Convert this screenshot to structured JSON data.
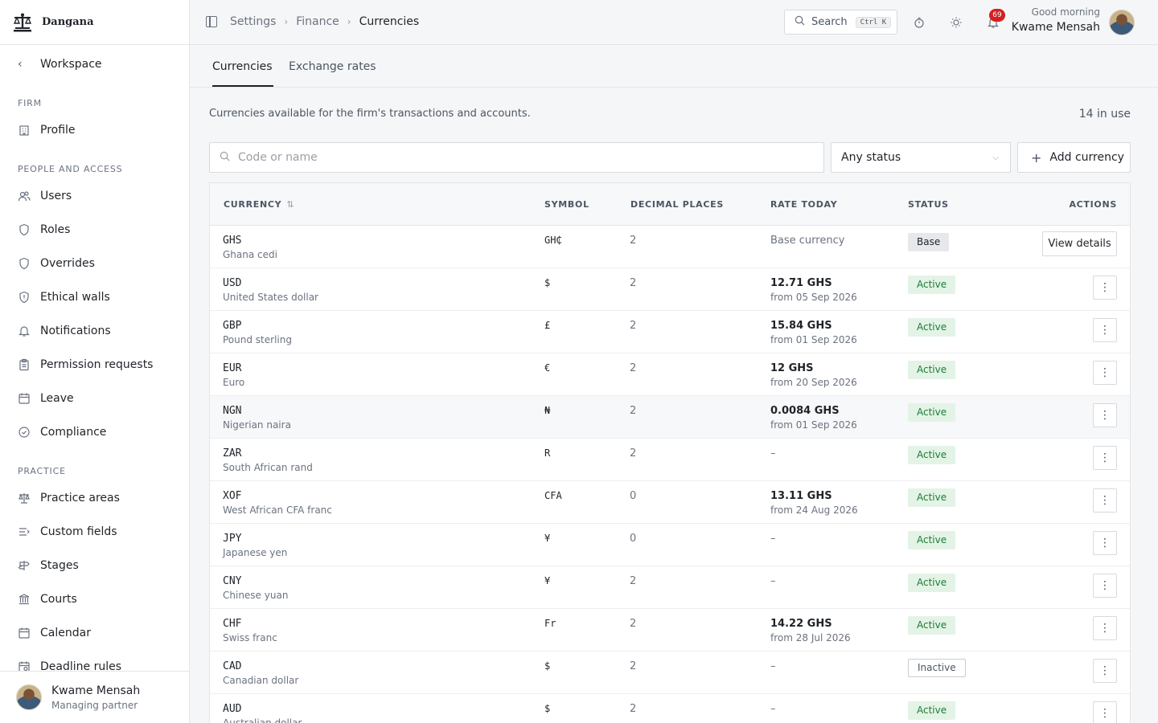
{
  "brand": {
    "name": "Dangana"
  },
  "sidebar": {
    "back_label": "Workspace",
    "sections": {
      "firm": "FIRM",
      "people": "PEOPLE AND ACCESS",
      "practice": "PRACTICE"
    },
    "items": [
      {
        "label": "Profile",
        "icon": "building-icon"
      },
      {
        "label": "Users",
        "icon": "users-icon"
      },
      {
        "label": "Roles",
        "icon": "shield-icon"
      },
      {
        "label": "Overrides",
        "icon": "shield-icon"
      },
      {
        "label": "Ethical walls",
        "icon": "shield-alert-icon"
      },
      {
        "label": "Notifications",
        "icon": "bell-icon"
      },
      {
        "label": "Permission requests",
        "icon": "clipboard-icon"
      },
      {
        "label": "Leave",
        "icon": "calendar-icon"
      },
      {
        "label": "Compliance",
        "icon": "check-circle-icon"
      },
      {
        "label": "Practice areas",
        "icon": "scale-icon"
      },
      {
        "label": "Custom fields",
        "icon": "text-fields-icon"
      },
      {
        "label": "Stages",
        "icon": "signpost-icon"
      },
      {
        "label": "Courts",
        "icon": "courthouse-icon"
      },
      {
        "label": "Calendar",
        "icon": "calendar-icon"
      },
      {
        "label": "Deadline rules",
        "icon": "calendar-clock-icon"
      }
    ],
    "user": {
      "name": "Kwame Mensah",
      "role": "Managing partner"
    }
  },
  "topbar": {
    "breadcrumbs": [
      "Settings",
      "Finance",
      "Currencies"
    ],
    "search_label": "Search",
    "search_shortcut": "Ctrl K",
    "notification_count": "69",
    "greeting": "Good morning",
    "user_name": "Kwame Mensah"
  },
  "tabs": [
    "Currencies",
    "Exchange rates"
  ],
  "page": {
    "description": "Currencies available for the firm's transactions and accounts.",
    "in_use": "14 in use",
    "search_placeholder": "Code or name",
    "status_filter": "Any status",
    "add_label": "Add currency"
  },
  "table": {
    "headers": [
      "CURRENCY",
      "SYMBOL",
      "DECIMAL PLACES",
      "RATE TODAY",
      "STATUS",
      "ACTIONS"
    ],
    "view_details_label": "View details",
    "rows": [
      {
        "code": "GHS",
        "name": "Ghana cedi",
        "symbol": "GH₵",
        "decimals": "2",
        "rate": "Base currency",
        "rate_from": "",
        "status": "Base"
      },
      {
        "code": "USD",
        "name": "United States dollar",
        "symbol": "$",
        "decimals": "2",
        "rate": "12.71 GHS",
        "rate_from": "from 05 Sep 2026",
        "status": "Active"
      },
      {
        "code": "GBP",
        "name": "Pound sterling",
        "symbol": "£",
        "decimals": "2",
        "rate": "15.84 GHS",
        "rate_from": "from 01 Sep 2026",
        "status": "Active"
      },
      {
        "code": "EUR",
        "name": "Euro",
        "symbol": "€",
        "decimals": "2",
        "rate": "12 GHS",
        "rate_from": "from 20 Sep 2026",
        "status": "Active"
      },
      {
        "code": "NGN",
        "name": "Nigerian naira",
        "symbol": "₦",
        "decimals": "2",
        "rate": "0.0084 GHS",
        "rate_from": "from 01 Sep 2026",
        "status": "Active"
      },
      {
        "code": "ZAR",
        "name": "South African rand",
        "symbol": "R",
        "decimals": "2",
        "rate": "–",
        "rate_from": "",
        "status": "Active"
      },
      {
        "code": "XOF",
        "name": "West African CFA franc",
        "symbol": "CFA",
        "decimals": "0",
        "rate": "13.11 GHS",
        "rate_from": "from 24 Aug 2026",
        "status": "Active"
      },
      {
        "code": "JPY",
        "name": "Japanese yen",
        "symbol": "¥",
        "decimals": "0",
        "rate": "–",
        "rate_from": "",
        "status": "Active"
      },
      {
        "code": "CNY",
        "name": "Chinese yuan",
        "symbol": "¥",
        "decimals": "2",
        "rate": "–",
        "rate_from": "",
        "status": "Active"
      },
      {
        "code": "CHF",
        "name": "Swiss franc",
        "symbol": "Fr",
        "decimals": "2",
        "rate": "14.22 GHS",
        "rate_from": "from 28 Jul 2026",
        "status": "Active"
      },
      {
        "code": "CAD",
        "name": "Canadian dollar",
        "symbol": "$",
        "decimals": "2",
        "rate": "–",
        "rate_from": "",
        "status": "Inactive"
      },
      {
        "code": "AUD",
        "name": "Australian dollar",
        "symbol": "$",
        "decimals": "2",
        "rate": "–",
        "rate_from": "",
        "status": "Active"
      }
    ]
  },
  "colors": {
    "active_bg": "#e3f4e6",
    "active_text": "#1f7a37",
    "badge": "#d42020",
    "base_bg": "#e6e8eb"
  }
}
